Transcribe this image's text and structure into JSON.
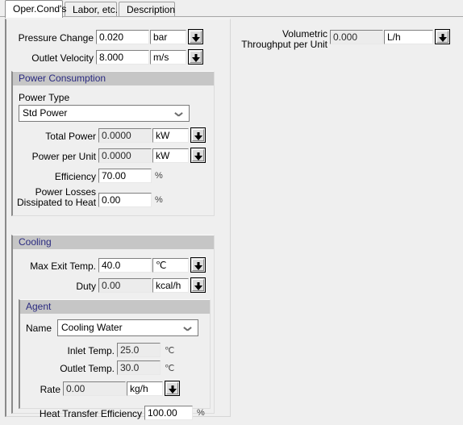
{
  "tabs": [
    {
      "label": "Oper.Cond's",
      "active": true
    },
    {
      "label": "Labor, etc.",
      "active": false
    },
    {
      "label": "Description",
      "active": false
    }
  ],
  "top_fields": {
    "pressure_change": {
      "label": "Pressure Change",
      "value": "0.020",
      "unit": "bar",
      "readonly": false,
      "spinner": "dropdown-arrow-icon"
    },
    "outlet_velocity": {
      "label": "Outlet Velocity",
      "value": "8.000",
      "unit": "m/s",
      "readonly": false,
      "spinner": "dropdown-arrow-icon"
    },
    "volumetric_throughput": {
      "label_line1": "Volumetric",
      "label_line2": "Throughput per Unit",
      "value": "0.000",
      "unit": "L/h",
      "readonly": true,
      "spinner": "dropdown-arrow-icon"
    }
  },
  "power_consumption": {
    "title": "Power Consumption",
    "power_type": {
      "label": "Power Type",
      "selected": "Std Power",
      "options": [
        "Std Power"
      ]
    },
    "total_power": {
      "label": "Total Power",
      "value": "0.0000",
      "unit": "kW",
      "readonly": true
    },
    "power_per_unit": {
      "label": "Power per Unit",
      "value": "0.0000",
      "unit": "kW",
      "readonly": true
    },
    "efficiency": {
      "label": "Efficiency",
      "value": "70.00",
      "unit": "%",
      "readonly": false
    },
    "power_losses": {
      "label_line1": "Power Losses",
      "label_line2": "Dissipated to Heat",
      "value": "0.00",
      "unit": "%",
      "readonly": false
    }
  },
  "cooling": {
    "title": "Cooling",
    "max_exit_temp": {
      "label": "Max Exit Temp.",
      "value": "40.0",
      "unit": "℃",
      "readonly": false
    },
    "duty": {
      "label": "Duty",
      "value": "0.00",
      "unit": "kcal/h",
      "readonly": true
    },
    "agent": {
      "title": "Agent",
      "name": {
        "label": "Name",
        "selected": "Cooling Water",
        "options": [
          "Cooling Water"
        ]
      },
      "inlet_temp": {
        "label": "Inlet Temp.",
        "value": "25.0",
        "unit": "℃",
        "readonly": true
      },
      "outlet_temp": {
        "label": "Outlet Temp.",
        "value": "30.0",
        "unit": "℃",
        "readonly": true
      },
      "rate": {
        "label": "Rate",
        "value": "0.00",
        "unit": "kg/h",
        "readonly": true
      },
      "heat_transfer_efficiency": {
        "label": "Heat Transfer Efficiency",
        "value": "100.00",
        "unit": "%",
        "readonly": false
      }
    }
  }
}
